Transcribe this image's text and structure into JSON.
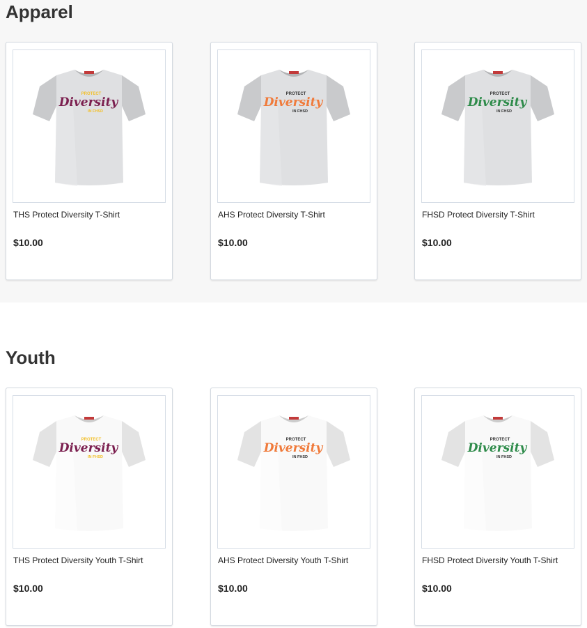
{
  "sections": [
    {
      "title": "Apparel",
      "products": [
        {
          "name": "THS Protect Diversity T-Shirt",
          "price": "$10.00",
          "shirt_color": "#dfe0e2",
          "accent_color": "#7b1f4f",
          "secondary_color": "#f2c02c"
        },
        {
          "name": "AHS Protect Diversity T-Shirt",
          "price": "$10.00",
          "shirt_color": "#dfe0e2",
          "accent_color": "#f07a3a",
          "secondary_color": "#333333"
        },
        {
          "name": "FHSD Protect Diversity T-Shirt",
          "price": "$10.00",
          "shirt_color": "#dfe0e2",
          "accent_color": "#2e8b4a",
          "secondary_color": "#333333"
        }
      ]
    },
    {
      "title": "Youth",
      "products": [
        {
          "name": "THS Protect Diversity Youth T-Shirt",
          "price": "$10.00",
          "shirt_color": "#f9f9f9",
          "accent_color": "#7b1f4f",
          "secondary_color": "#f2c02c"
        },
        {
          "name": "AHS Protect Diversity Youth T-Shirt",
          "price": "$10.00",
          "shirt_color": "#f9f9f9",
          "accent_color": "#f07a3a",
          "secondary_color": "#333333"
        },
        {
          "name": "FHSD Protect Diversity Youth T-Shirt",
          "price": "$10.00",
          "shirt_color": "#f9f9f9",
          "accent_color": "#2e8b4a",
          "secondary_color": "#333333"
        }
      ]
    }
  ],
  "logo": {
    "top": "PROTECT",
    "main": "Diversity",
    "bottom": "IN FHSD"
  },
  "icons": {
    "product_image": "tshirt-image"
  }
}
